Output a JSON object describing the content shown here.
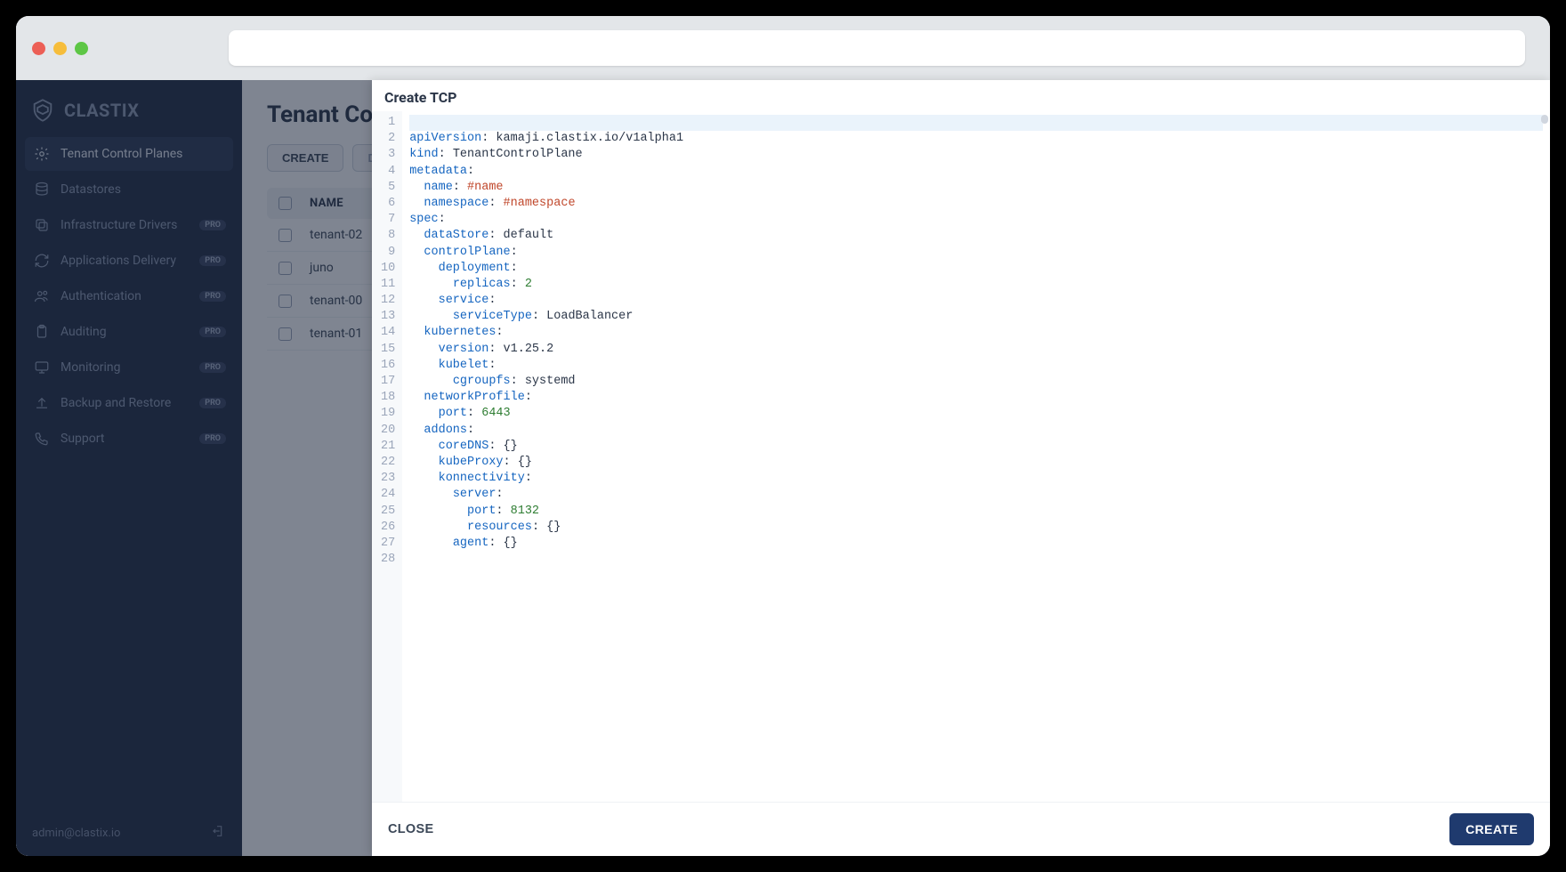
{
  "brand": {
    "name": "CLASTIX"
  },
  "sidebar": {
    "items": [
      {
        "label": "Tenant Control Planes",
        "icon": "gear",
        "active": true,
        "badge": null
      },
      {
        "label": "Datastores",
        "icon": "db",
        "active": false,
        "badge": null
      },
      {
        "label": "Infrastructure Drivers",
        "icon": "copy",
        "active": false,
        "badge": "PRO"
      },
      {
        "label": "Applications Delivery",
        "icon": "refresh",
        "active": false,
        "badge": "PRO"
      },
      {
        "label": "Authentication",
        "icon": "users",
        "active": false,
        "badge": "PRO"
      },
      {
        "label": "Auditing",
        "icon": "clip",
        "active": false,
        "badge": "PRO"
      },
      {
        "label": "Monitoring",
        "icon": "monitor",
        "active": false,
        "badge": "PRO"
      },
      {
        "label": "Backup and Restore",
        "icon": "upload",
        "active": false,
        "badge": "PRO"
      },
      {
        "label": "Support",
        "icon": "phone",
        "active": false,
        "badge": "PRO"
      }
    ],
    "footer_user": "admin@clastix.io"
  },
  "page": {
    "title": "Tenant Control Planes",
    "toolbar": {
      "create": "CREATE",
      "second": "D"
    },
    "table": {
      "header_name": "NAME",
      "rows": [
        {
          "name": "tenant-02"
        },
        {
          "name": "juno"
        },
        {
          "name": "tenant-00"
        },
        {
          "name": "tenant-01"
        }
      ]
    }
  },
  "drawer": {
    "title": "Create TCP",
    "close_label": "CLOSE",
    "create_label": "CREATE",
    "yaml_lines": [
      [],
      [
        [
          "key",
          "apiVersion"
        ],
        [
          "colon",
          ": "
        ],
        [
          "str",
          "kamaji.clastix.io/v1alpha1"
        ]
      ],
      [
        [
          "key",
          "kind"
        ],
        [
          "colon",
          ": "
        ],
        [
          "str",
          "TenantControlPlane"
        ]
      ],
      [
        [
          "key",
          "metadata"
        ],
        [
          "colon",
          ":"
        ]
      ],
      [
        [
          "indent",
          "  "
        ],
        [
          "key",
          "name"
        ],
        [
          "colon",
          ": "
        ],
        [
          "tmpl",
          "#name"
        ]
      ],
      [
        [
          "indent",
          "  "
        ],
        [
          "key",
          "namespace"
        ],
        [
          "colon",
          ": "
        ],
        [
          "tmpl",
          "#namespace"
        ]
      ],
      [
        [
          "key",
          "spec"
        ],
        [
          "colon",
          ":"
        ]
      ],
      [
        [
          "indent",
          "  "
        ],
        [
          "key",
          "dataStore"
        ],
        [
          "colon",
          ": "
        ],
        [
          "str",
          "default"
        ]
      ],
      [
        [
          "indent",
          "  "
        ],
        [
          "key",
          "controlPlane"
        ],
        [
          "colon",
          ":"
        ]
      ],
      [
        [
          "indent",
          "    "
        ],
        [
          "key",
          "deployment"
        ],
        [
          "colon",
          ":"
        ]
      ],
      [
        [
          "indent",
          "      "
        ],
        [
          "key",
          "replicas"
        ],
        [
          "colon",
          ": "
        ],
        [
          "num",
          "2"
        ]
      ],
      [
        [
          "indent",
          "    "
        ],
        [
          "key",
          "service"
        ],
        [
          "colon",
          ":"
        ]
      ],
      [
        [
          "indent",
          "      "
        ],
        [
          "key",
          "serviceType"
        ],
        [
          "colon",
          ": "
        ],
        [
          "str",
          "LoadBalancer"
        ]
      ],
      [
        [
          "indent",
          "  "
        ],
        [
          "key",
          "kubernetes"
        ],
        [
          "colon",
          ":"
        ]
      ],
      [
        [
          "indent",
          "    "
        ],
        [
          "key",
          "version"
        ],
        [
          "colon",
          ": "
        ],
        [
          "str",
          "v1.25.2"
        ]
      ],
      [
        [
          "indent",
          "    "
        ],
        [
          "key",
          "kubelet"
        ],
        [
          "colon",
          ":"
        ]
      ],
      [
        [
          "indent",
          "      "
        ],
        [
          "key",
          "cgroupfs"
        ],
        [
          "colon",
          ": "
        ],
        [
          "str",
          "systemd"
        ]
      ],
      [
        [
          "indent",
          "  "
        ],
        [
          "key",
          "networkProfile"
        ],
        [
          "colon",
          ":"
        ]
      ],
      [
        [
          "indent",
          "    "
        ],
        [
          "key",
          "port"
        ],
        [
          "colon",
          ": "
        ],
        [
          "num",
          "6443"
        ]
      ],
      [
        [
          "indent",
          "  "
        ],
        [
          "key",
          "addons"
        ],
        [
          "colon",
          ":"
        ]
      ],
      [
        [
          "indent",
          "    "
        ],
        [
          "key",
          "coreDNS"
        ],
        [
          "colon",
          ": "
        ],
        [
          "str",
          "{}"
        ]
      ],
      [
        [
          "indent",
          "    "
        ],
        [
          "key",
          "kubeProxy"
        ],
        [
          "colon",
          ": "
        ],
        [
          "str",
          "{}"
        ]
      ],
      [
        [
          "indent",
          "    "
        ],
        [
          "key",
          "konnectivity"
        ],
        [
          "colon",
          ":"
        ]
      ],
      [
        [
          "indent",
          "      "
        ],
        [
          "key",
          "server"
        ],
        [
          "colon",
          ":"
        ]
      ],
      [
        [
          "indent",
          "        "
        ],
        [
          "key",
          "port"
        ],
        [
          "colon",
          ": "
        ],
        [
          "num",
          "8132"
        ]
      ],
      [
        [
          "indent",
          "        "
        ],
        [
          "key",
          "resources"
        ],
        [
          "colon",
          ": "
        ],
        [
          "str",
          "{}"
        ]
      ],
      [
        [
          "indent",
          "      "
        ],
        [
          "key",
          "agent"
        ],
        [
          "colon",
          ": "
        ],
        [
          "str",
          "{}"
        ]
      ],
      []
    ]
  }
}
